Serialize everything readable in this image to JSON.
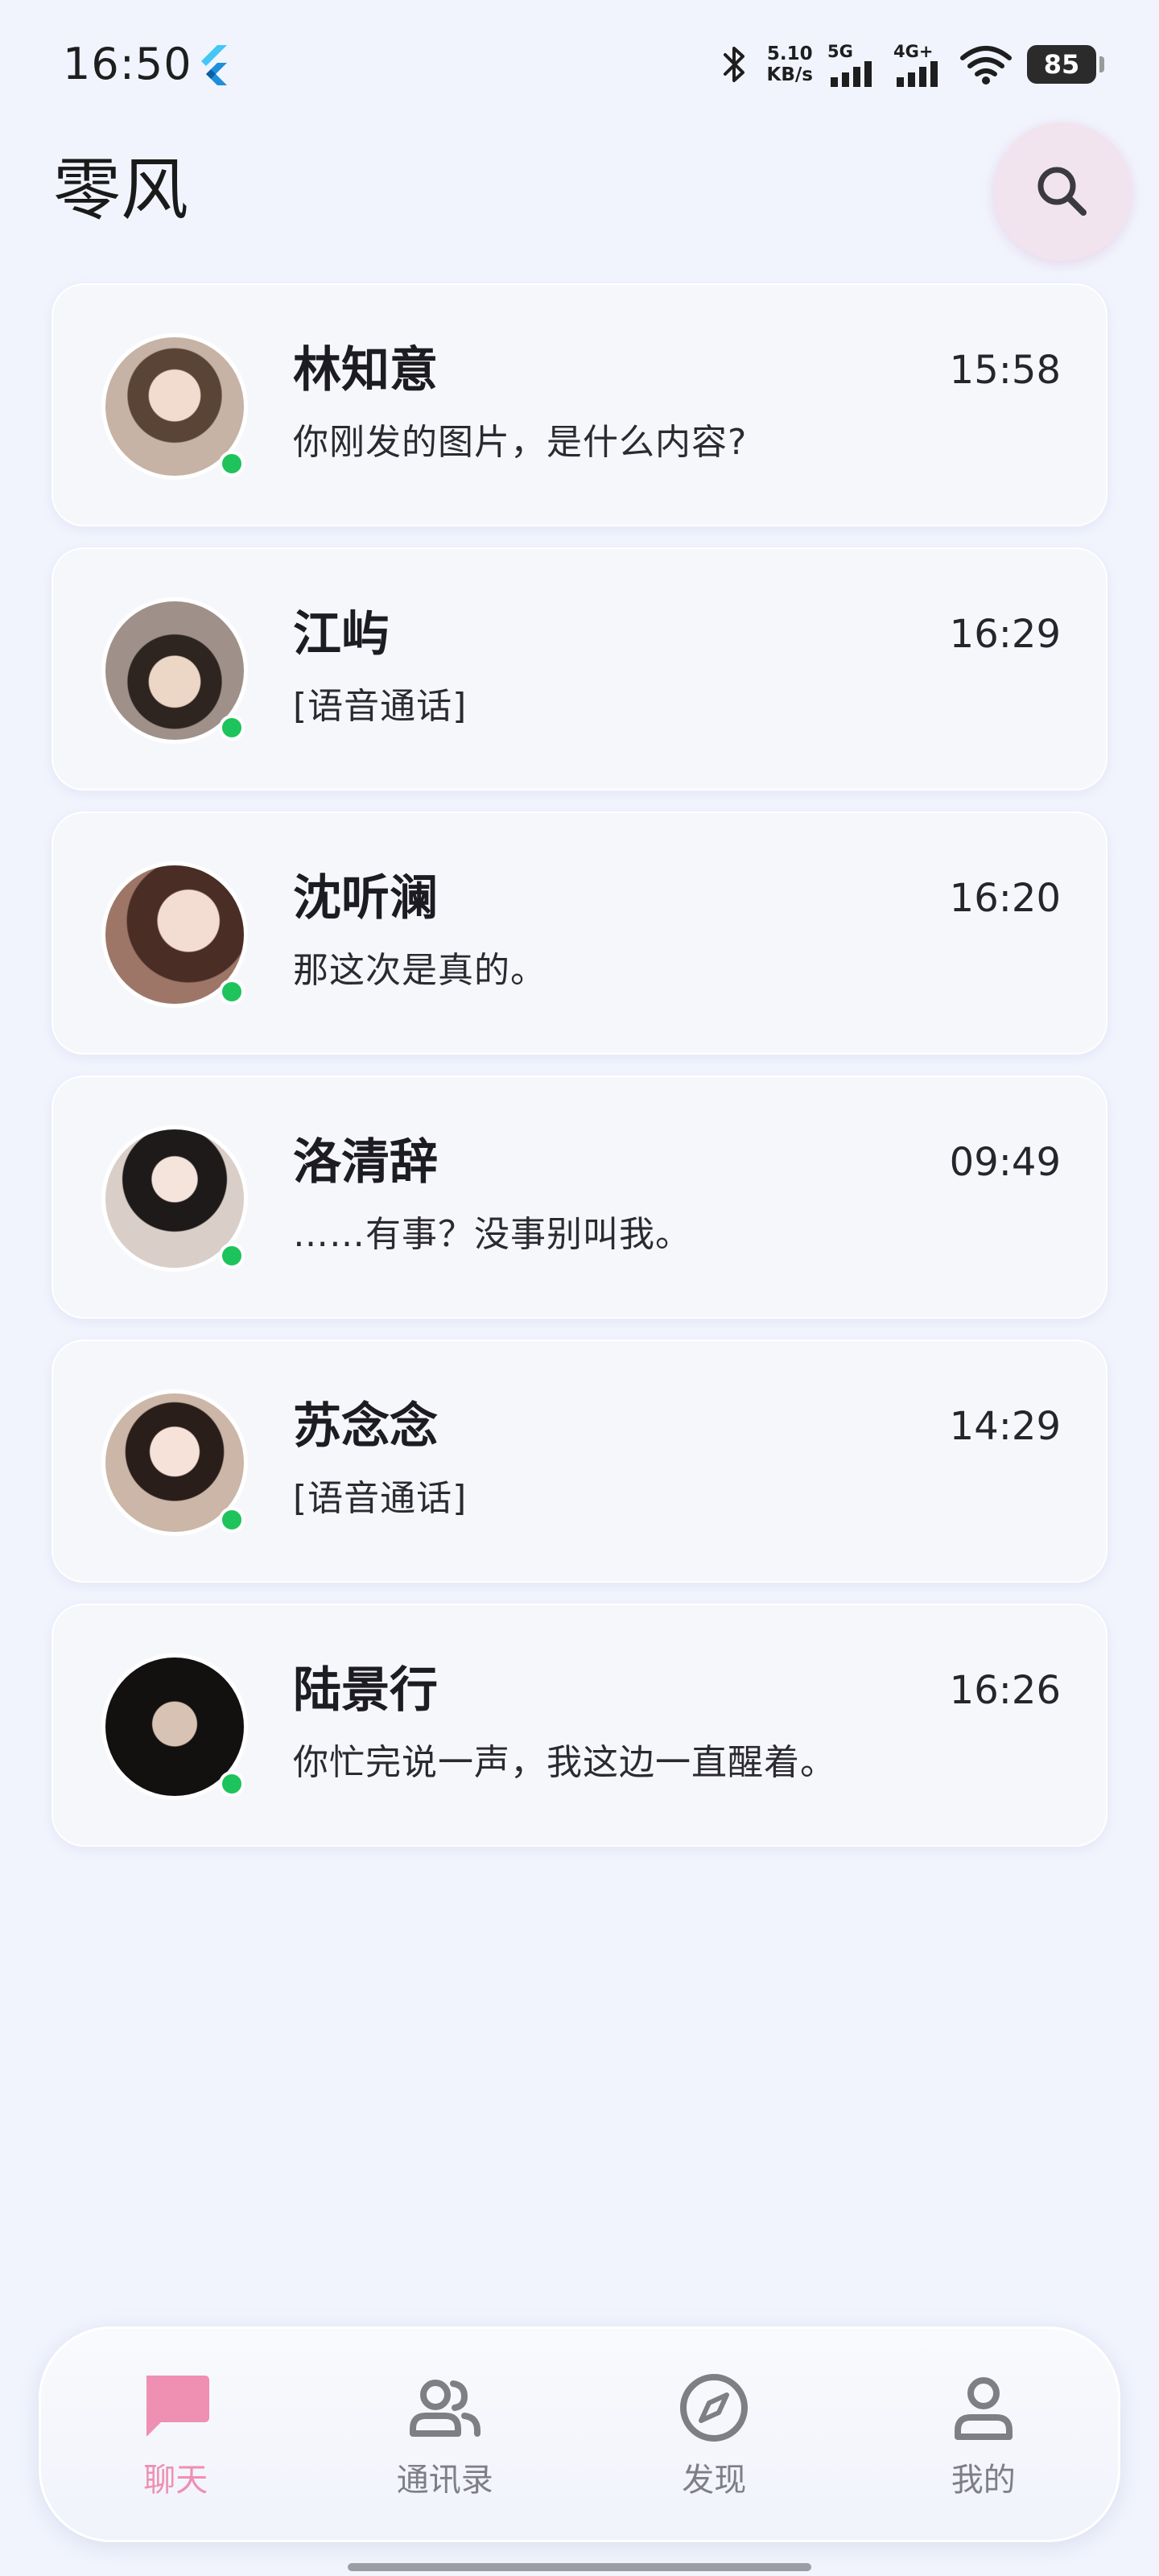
{
  "status_bar": {
    "time": "16:50",
    "net_speed_value": "5.10",
    "net_speed_unit": "KB/s",
    "sim1_label": "5G",
    "sim2_label": "4G+",
    "battery": "85"
  },
  "header": {
    "title": "零风",
    "search_icon": "search-icon"
  },
  "chats": [
    {
      "name": "林知意",
      "time": "15:58",
      "preview": "你刚发的图片，是什么内容?",
      "online": true,
      "avatar_color": "#b79a86"
    },
    {
      "name": "江屿",
      "time": "16:29",
      "preview": "[语音通话]",
      "online": true,
      "avatar_color": "#8f7a6c"
    },
    {
      "name": "沈听澜",
      "time": "16:20",
      "preview": "那这次是真的。",
      "online": true,
      "avatar_color": "#a88274"
    },
    {
      "name": "洛清辞",
      "time": "09:49",
      "preview": "……有事？没事别叫我。",
      "online": true,
      "avatar_color": "#c8bcb4"
    },
    {
      "name": "苏念念",
      "time": "14:29",
      "preview": "[语音通话]",
      "online": true,
      "avatar_color": "#c9aea2"
    },
    {
      "name": "陆景行",
      "time": "16:26",
      "preview": "你忙完说一声，我这边一直醒着。",
      "online": true,
      "avatar_color": "#2a2826"
    }
  ],
  "nav": {
    "items": [
      {
        "label": "聊天",
        "icon": "chat-bubble-icon",
        "active": true
      },
      {
        "label": "通讯录",
        "icon": "contacts-icon",
        "active": false
      },
      {
        "label": "发现",
        "icon": "compass-icon",
        "active": false
      },
      {
        "label": "我的",
        "icon": "profile-icon",
        "active": false
      }
    ]
  },
  "colors": {
    "accent_pink": "#ef8fb2",
    "online_green": "#1fc35c",
    "background": "#f1f4fd"
  }
}
